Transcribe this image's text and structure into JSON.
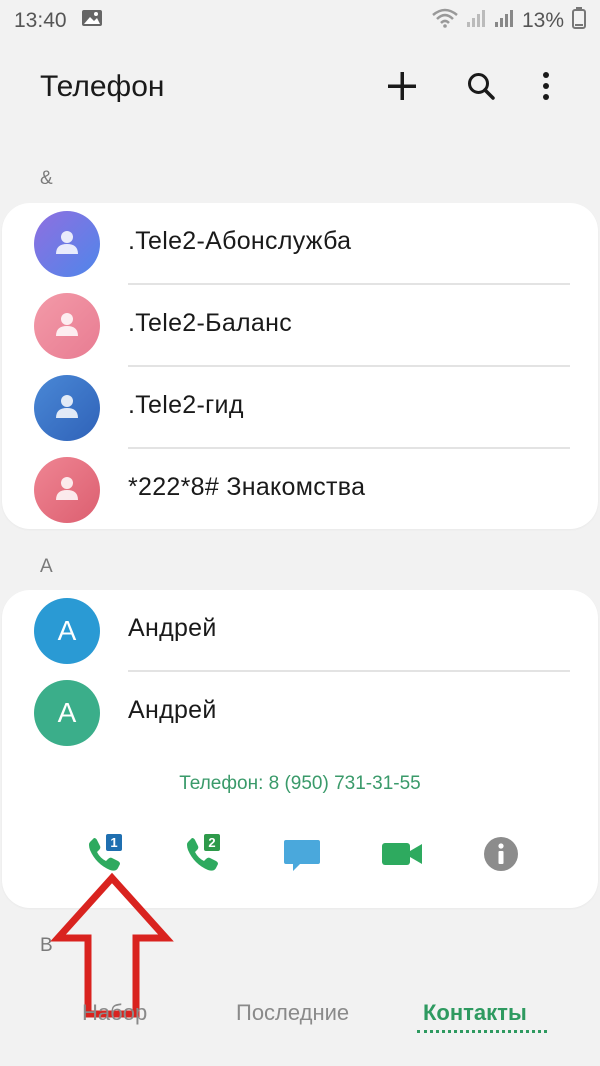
{
  "status": {
    "time": "13:40",
    "battery": "13%"
  },
  "appbar": {
    "title": "Телефон",
    "icons": [
      "add-icon",
      "search-icon",
      "more-vertical-icon"
    ]
  },
  "sections": [
    {
      "header": "&",
      "contacts": [
        {
          "name": ".Tele2-Абонслужба",
          "avatar_color": "#6d7ee8"
        },
        {
          "name": ".Tele2-Баланс",
          "avatar_color": "#ee8a9b"
        },
        {
          "name": ".Tele2-гид",
          "avatar_color": "#3f74c8"
        },
        {
          "name": "*222*8# Знакомства",
          "avatar_color": "#e36b7b"
        }
      ]
    },
    {
      "header": "А",
      "contacts": [
        {
          "name": "Андрей",
          "avatar_letter": "А",
          "avatar_color": "#2a9ad4"
        },
        {
          "name": "Андрей",
          "avatar_letter": "А",
          "avatar_color": "#3bae8a"
        }
      ],
      "expanded_phone": "Телефон: 8 (950) 731-31-55",
      "actions": [
        "call-sim1-icon",
        "call-sim2-icon",
        "message-icon",
        "video-call-icon",
        "info-icon"
      ],
      "sim1_badge": "1",
      "sim2_badge": "2"
    },
    {
      "header": "В"
    }
  ],
  "tabs": [
    {
      "label": "Набор",
      "active": false
    },
    {
      "label": "Последние",
      "active": false
    },
    {
      "label": "Контакты",
      "active": true
    }
  ],
  "colors": {
    "accent": "#2e9a60",
    "annotation_arrow": "#d9231f"
  }
}
